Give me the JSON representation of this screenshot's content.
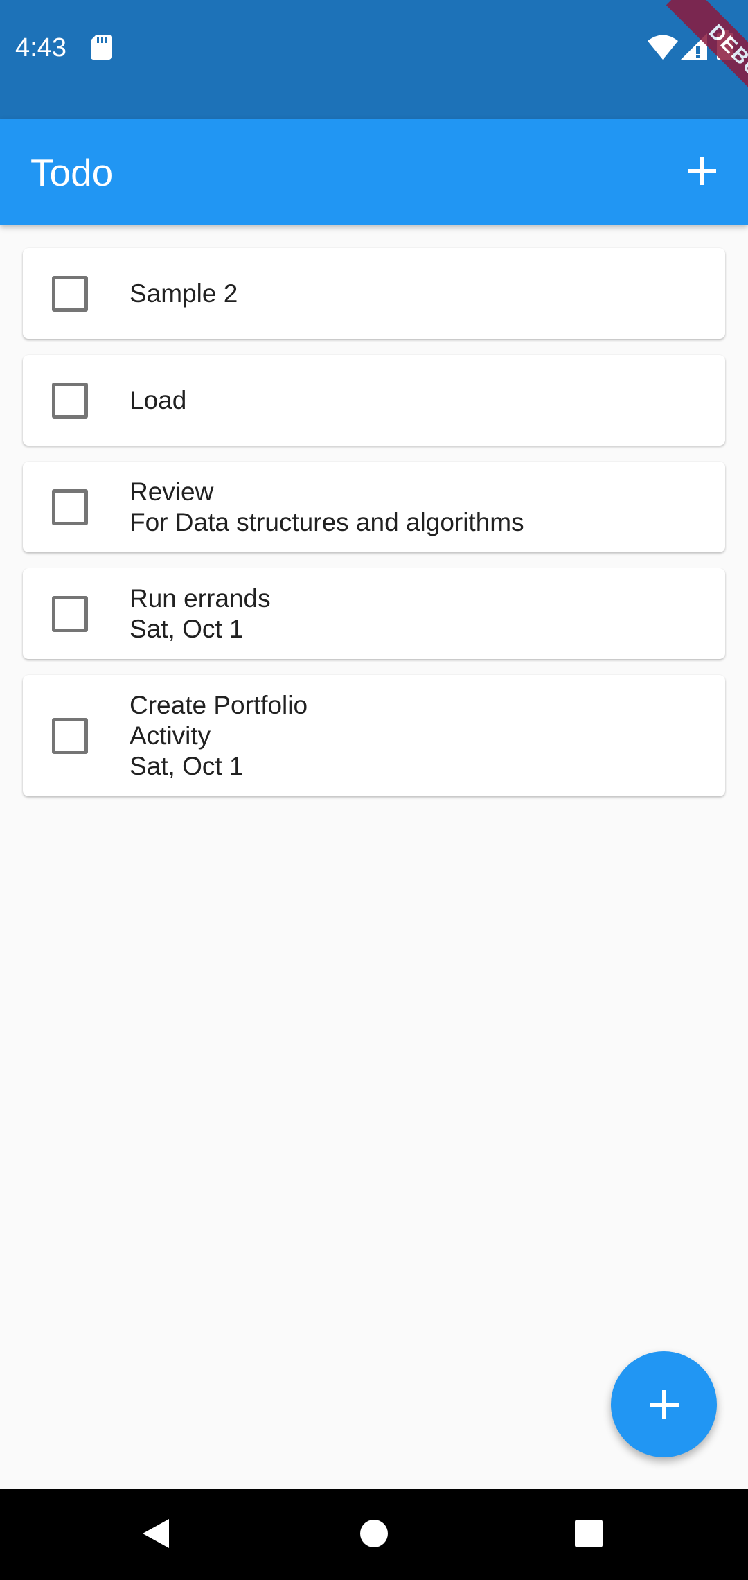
{
  "status_bar": {
    "time": "4:43",
    "icons": [
      "sd-card-icon",
      "wifi-icon",
      "signal-icon",
      "battery-icon"
    ],
    "debug_banner": "DEBUG",
    "background": "#1d72b8"
  },
  "app_bar": {
    "title": "Todo",
    "action_icon": "add-icon",
    "background": "#2196f3"
  },
  "todos": [
    {
      "lines": [
        "Sample 2"
      ],
      "checked": false
    },
    {
      "lines": [
        "Load"
      ],
      "checked": false
    },
    {
      "lines": [
        "Review",
        "For Data structures and algorithms"
      ],
      "checked": false
    },
    {
      "lines": [
        "Run errands",
        "Sat, Oct 1"
      ],
      "checked": false
    },
    {
      "lines": [
        "Create Portfolio",
        "Activity",
        "Sat, Oct 1"
      ],
      "checked": false
    }
  ],
  "fab": {
    "icon": "add-icon",
    "color": "#2196f3"
  },
  "nav_bar": {
    "buttons": [
      "back-icon",
      "home-icon",
      "recents-icon"
    ]
  }
}
